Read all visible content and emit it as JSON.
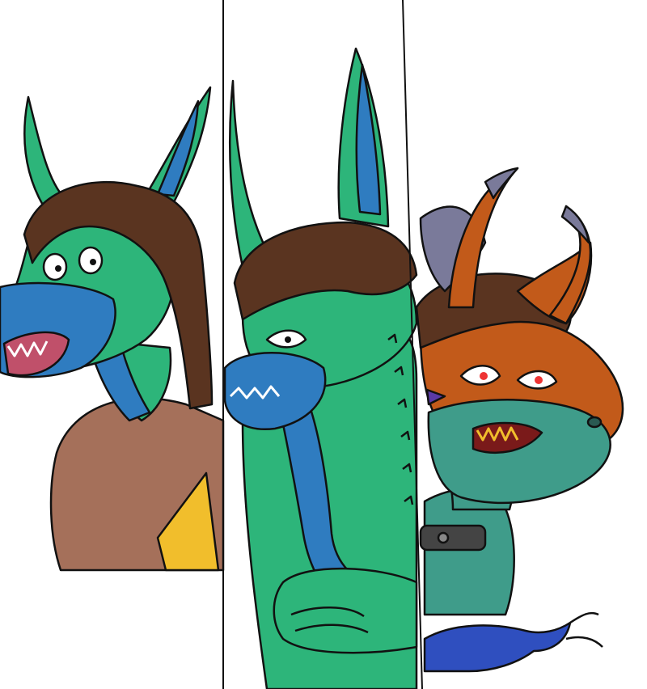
{
  "image": {
    "panels": [
      {
        "name": "panel-left",
        "subject": "green-dragon-with-brown-hair"
      },
      {
        "name": "panel-middle",
        "subject": "green-spiky-dragon-arms-crossed"
      },
      {
        "name": "panel-right",
        "subject": "orange-horned-dragon"
      }
    ]
  },
  "palette": {
    "background": "#ffffff",
    "green": "#2db57a",
    "blue": "#2f7cc0",
    "brown_hair": "#5a3420",
    "shirt": "#a5705a",
    "yellow": "#f1be2c",
    "orange": "#c25a1a",
    "teal": "#3f9c8a",
    "horn": "#7a7a9a",
    "outline": "#111111"
  }
}
